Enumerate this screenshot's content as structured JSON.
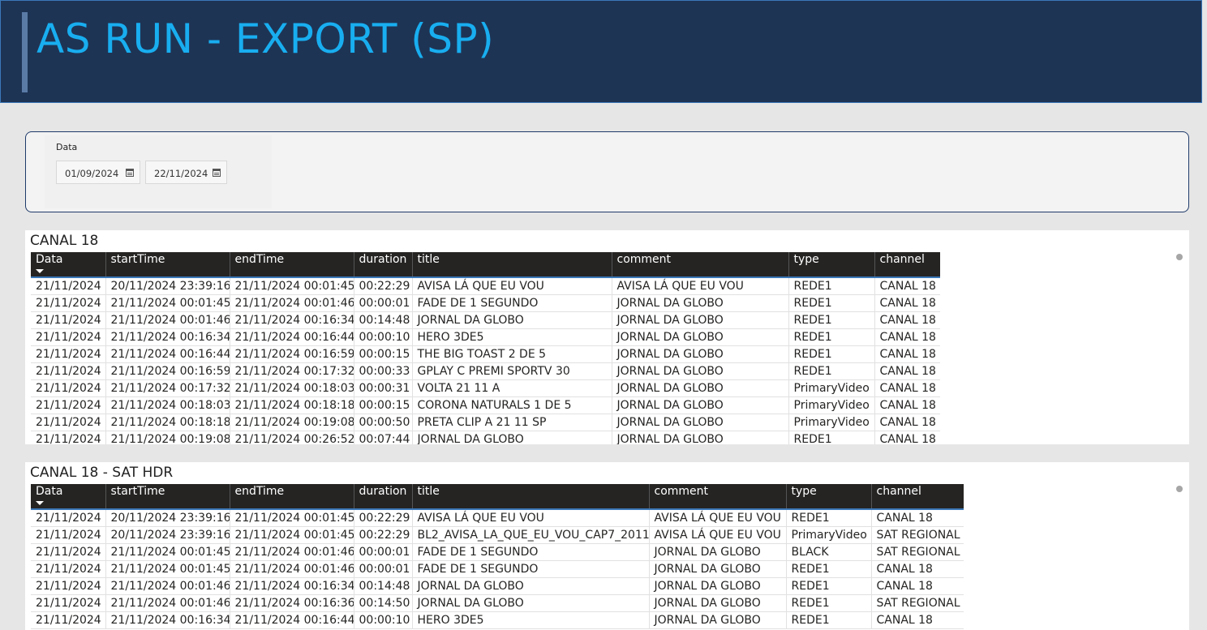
{
  "header": {
    "title": "AS RUN - EXPORT (SP)"
  },
  "filter": {
    "label": "Data",
    "start_date": "01/09/2024",
    "end_date": "22/11/2024"
  },
  "tables": [
    {
      "title": "CANAL 18",
      "columns": [
        "Data",
        "startTime",
        "endTime",
        "duration",
        "title",
        "comment",
        "type",
        "channel"
      ],
      "rows": [
        [
          "21/11/2024",
          "20/11/2024 23:39:16",
          "21/11/2024 00:01:45",
          "00:22:29",
          "AVISA LÁ QUE EU VOU",
          "AVISA LÁ QUE EU VOU",
          "REDE1",
          "CANAL 18"
        ],
        [
          "21/11/2024",
          "21/11/2024 00:01:45",
          "21/11/2024 00:01:46",
          "00:00:01",
          "FADE DE 1 SEGUNDO",
          "JORNAL DA GLOBO",
          "REDE1",
          "CANAL 18"
        ],
        [
          "21/11/2024",
          "21/11/2024 00:01:46",
          "21/11/2024 00:16:34",
          "00:14:48",
          "JORNAL DA GLOBO",
          "JORNAL DA GLOBO",
          "REDE1",
          "CANAL 18"
        ],
        [
          "21/11/2024",
          "21/11/2024 00:16:34",
          "21/11/2024 00:16:44",
          "00:00:10",
          "HERO 3DE5",
          "JORNAL DA GLOBO",
          "REDE1",
          "CANAL 18"
        ],
        [
          "21/11/2024",
          "21/11/2024 00:16:44",
          "21/11/2024 00:16:59",
          "00:00:15",
          "THE BIG TOAST 2 DE 5",
          "JORNAL DA GLOBO",
          "REDE1",
          "CANAL 18"
        ],
        [
          "21/11/2024",
          "21/11/2024 00:16:59",
          "21/11/2024 00:17:32",
          "00:00:33",
          "GPLAY C PREMI SPORTV 30",
          "JORNAL DA GLOBO",
          "REDE1",
          "CANAL 18"
        ],
        [
          "21/11/2024",
          "21/11/2024 00:17:32",
          "21/11/2024 00:18:03",
          "00:00:31",
          "VOLTA 21 11 A",
          "JORNAL DA GLOBO",
          "PrimaryVideo",
          "CANAL 18"
        ],
        [
          "21/11/2024",
          "21/11/2024 00:18:03",
          "21/11/2024 00:18:18",
          "00:00:15",
          "CORONA NATURALS 1 DE 5",
          "JORNAL DA GLOBO",
          "PrimaryVideo",
          "CANAL 18"
        ],
        [
          "21/11/2024",
          "21/11/2024 00:18:18",
          "21/11/2024 00:19:08",
          "00:00:50",
          "PRETA CLIP A 21 11 SP",
          "JORNAL DA GLOBO",
          "PrimaryVideo",
          "CANAL 18"
        ],
        [
          "21/11/2024",
          "21/11/2024 00:19:08",
          "21/11/2024 00:26:52",
          "00:07:44",
          "JORNAL DA GLOBO",
          "JORNAL DA GLOBO",
          "REDE1",
          "CANAL 18"
        ]
      ]
    },
    {
      "title": "CANAL 18 - SAT HDR",
      "columns": [
        "Data",
        "startTime",
        "endTime",
        "duration",
        "title",
        "comment",
        "type",
        "channel"
      ],
      "rows": [
        [
          "21/11/2024",
          "20/11/2024 23:39:16",
          "21/11/2024 00:01:45",
          "00:22:29",
          "AVISA LÁ QUE EU VOU",
          "AVISA LÁ QUE EU VOU",
          "REDE1",
          "CANAL 18"
        ],
        [
          "21/11/2024",
          "20/11/2024 23:39:16",
          "21/11/2024 00:01:45",
          "00:22:29",
          "BL2_AVISA_LA_QUE_EU_VOU_CAP7_2011",
          "AVISA LÁ QUE EU VOU",
          "PrimaryVideo",
          "SAT REGIONAL"
        ],
        [
          "21/11/2024",
          "21/11/2024 00:01:45",
          "21/11/2024 00:01:46",
          "00:00:01",
          "FADE DE 1 SEGUNDO",
          "JORNAL DA GLOBO",
          "BLACK",
          "SAT REGIONAL"
        ],
        [
          "21/11/2024",
          "21/11/2024 00:01:45",
          "21/11/2024 00:01:46",
          "00:00:01",
          "FADE DE 1 SEGUNDO",
          "JORNAL DA GLOBO",
          "REDE1",
          "CANAL 18"
        ],
        [
          "21/11/2024",
          "21/11/2024 00:01:46",
          "21/11/2024 00:16:34",
          "00:14:48",
          "JORNAL DA GLOBO",
          "JORNAL DA GLOBO",
          "REDE1",
          "CANAL 18"
        ],
        [
          "21/11/2024",
          "21/11/2024 00:01:46",
          "21/11/2024 00:16:36",
          "00:14:50",
          "JORNAL DA GLOBO",
          "JORNAL DA GLOBO",
          "REDE1",
          "SAT REGIONAL"
        ],
        [
          "21/11/2024",
          "21/11/2024 00:16:34",
          "21/11/2024 00:16:44",
          "00:00:10",
          "HERO 3DE5",
          "JORNAL DA GLOBO",
          "REDE1",
          "CANAL 18"
        ]
      ]
    }
  ]
}
